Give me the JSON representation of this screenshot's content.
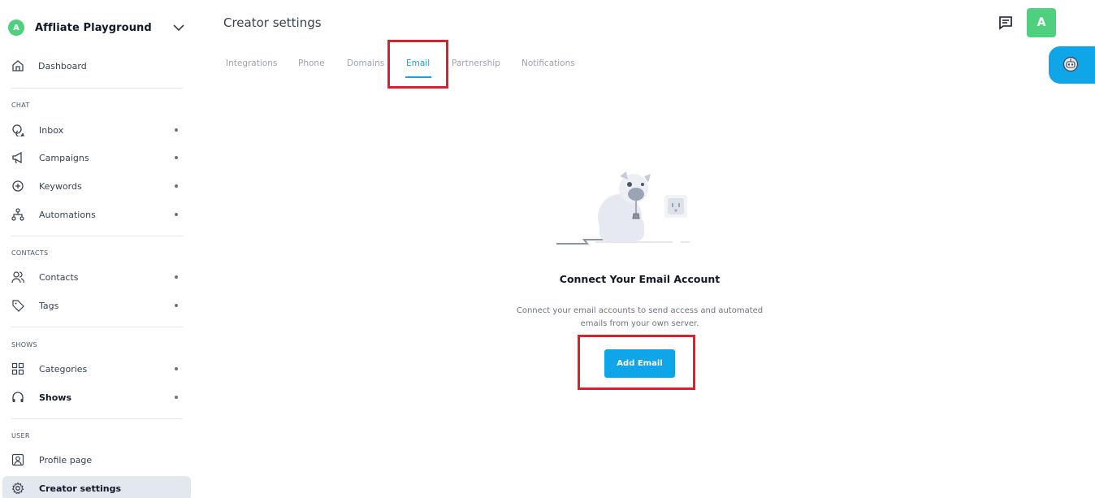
{
  "workspace": {
    "initial": "A",
    "name": "Affliate Playground"
  },
  "sidebar": {
    "dashboard": "Dashboard",
    "sections": {
      "chat": "CHAT",
      "contacts": "CONTACTS",
      "shows": "SHOWS",
      "user": "USER"
    },
    "items": {
      "inbox": "Inbox",
      "campaigns": "Campaigns",
      "keywords": "Keywords",
      "automations": "Automations",
      "contacts": "Contacts",
      "tags": "Tags",
      "categories": "Categories",
      "shows": "Shows",
      "profile_page": "Profile page",
      "creator_settings": "Creator settings"
    }
  },
  "header": {
    "title": "Creator settings",
    "user_initial": "A"
  },
  "tabs": {
    "integrations": "Integrations",
    "phone": "Phone",
    "domains": "Domains",
    "email": "Email",
    "partnership": "Partnership",
    "notifications": "Notifications",
    "active": "Email"
  },
  "empty_state": {
    "title": "Connect Your Email Account",
    "description": "Connect your email accounts to send access and automated emails from your own server.",
    "button_label": "Add Email"
  },
  "colors": {
    "accent": "#0ea5e9",
    "avatar_green": "#4fd07f",
    "highlight_red": "#e11d2e",
    "active_item_bg": "#e2e8ee"
  }
}
